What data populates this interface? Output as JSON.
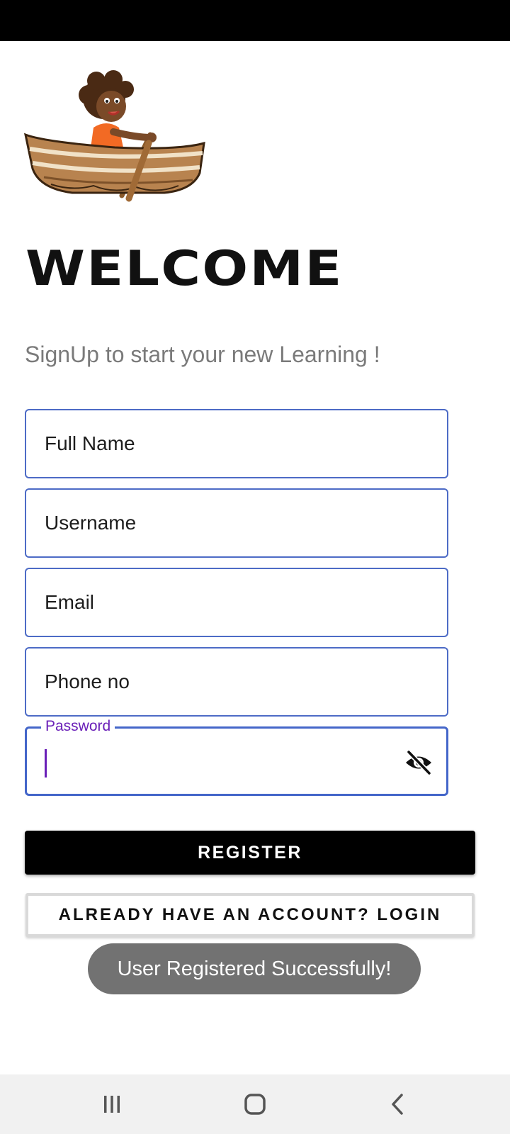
{
  "app": {
    "heading": "WELCOME",
    "subtitle": "SignUp to start your new Learning !"
  },
  "form": {
    "full_name_placeholder": "Full Name",
    "username_placeholder": "Username",
    "email_placeholder": "Email",
    "phone_placeholder": "Phone no",
    "password_label": "Password",
    "password_value": "",
    "password_toggle_icon": "eye-off-icon"
  },
  "buttons": {
    "register_label": "REGISTER",
    "login_label": "ALREADY HAVE AN ACCOUNT? LOGIN"
  },
  "toast": {
    "message": "User Registered Successfully!"
  },
  "nav": {
    "recents_icon": "recents-icon",
    "home_icon": "home-icon",
    "back_icon": "back-icon"
  },
  "colors": {
    "field_border": "#4d6bc6",
    "focus_accent": "#6a1fb8",
    "register_bg": "#000000",
    "toast_bg": "#727272"
  }
}
